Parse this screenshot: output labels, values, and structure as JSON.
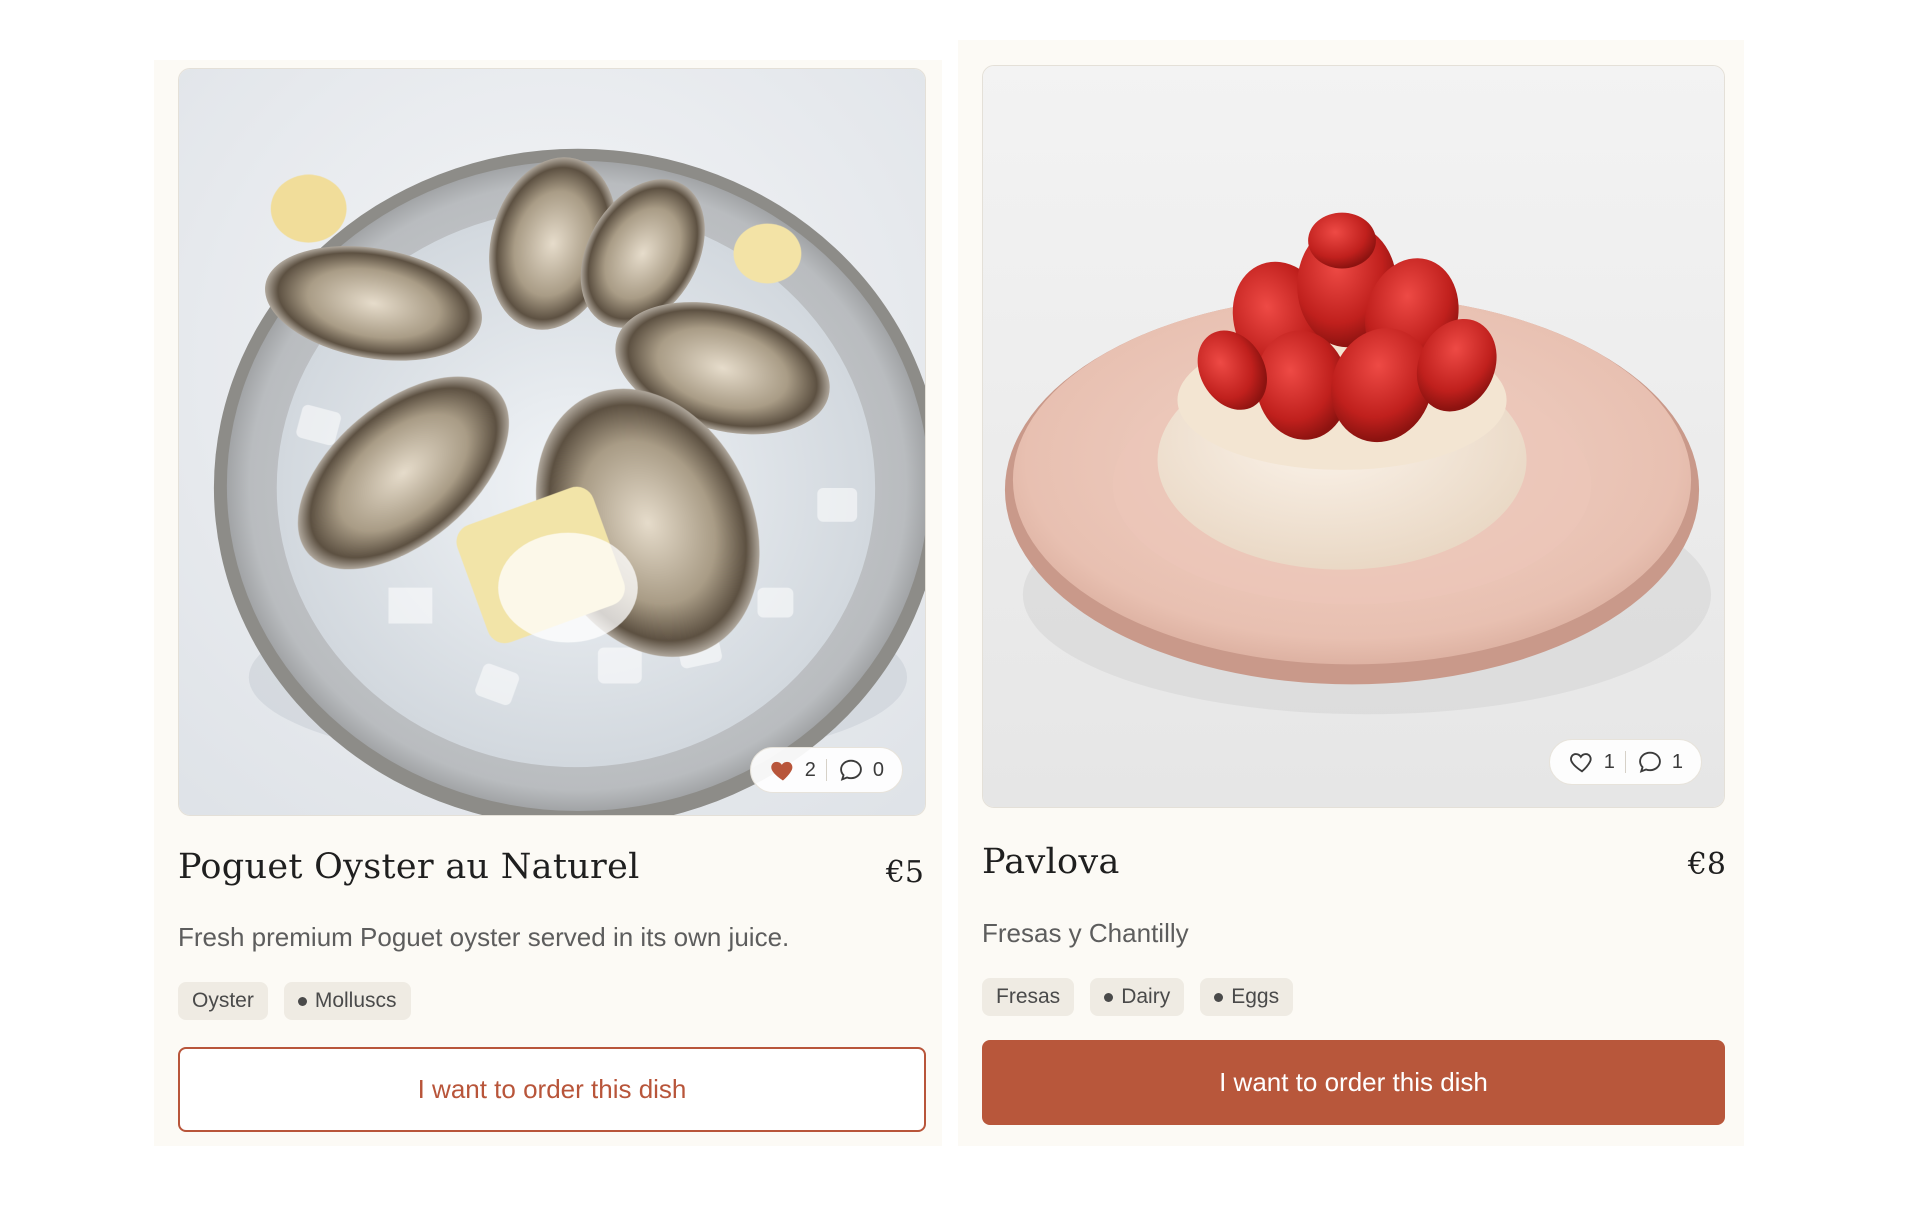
{
  "colors": {
    "accent": "#b8573b",
    "card_background": "#fcfaf5",
    "tag_background": "#efebe3",
    "liked_heart": "#b8553a"
  },
  "dishes": [
    {
      "name": "Poguet Oyster au Naturel",
      "price": "€5",
      "description": "Fresh premium Poguet oyster served in its own juice.",
      "tags": [
        {
          "label": "Oyster",
          "dot": false
        },
        {
          "label": "Molluscs",
          "dot": true
        }
      ],
      "likes": "2",
      "comments": "0",
      "liked": true,
      "like_icon": "heart-filled-icon",
      "comment_icon": "comment-bubble-icon",
      "image_alt": "oysters-on-ice-photo",
      "order_label": "I want to order this dish",
      "order_style": "outline"
    },
    {
      "name": "Pavlova",
      "price": "€8",
      "description": "Fresas y Chantilly",
      "tags": [
        {
          "label": "Fresas",
          "dot": false
        },
        {
          "label": "Dairy",
          "dot": true
        },
        {
          "label": "Eggs",
          "dot": true
        }
      ],
      "likes": "1",
      "comments": "1",
      "liked": false,
      "like_icon": "heart-outline-icon",
      "comment_icon": "comment-bubble-icon",
      "image_alt": "pavlova-with-strawberries-photo",
      "order_label": "I want to order this dish",
      "order_style": "filled"
    }
  ]
}
